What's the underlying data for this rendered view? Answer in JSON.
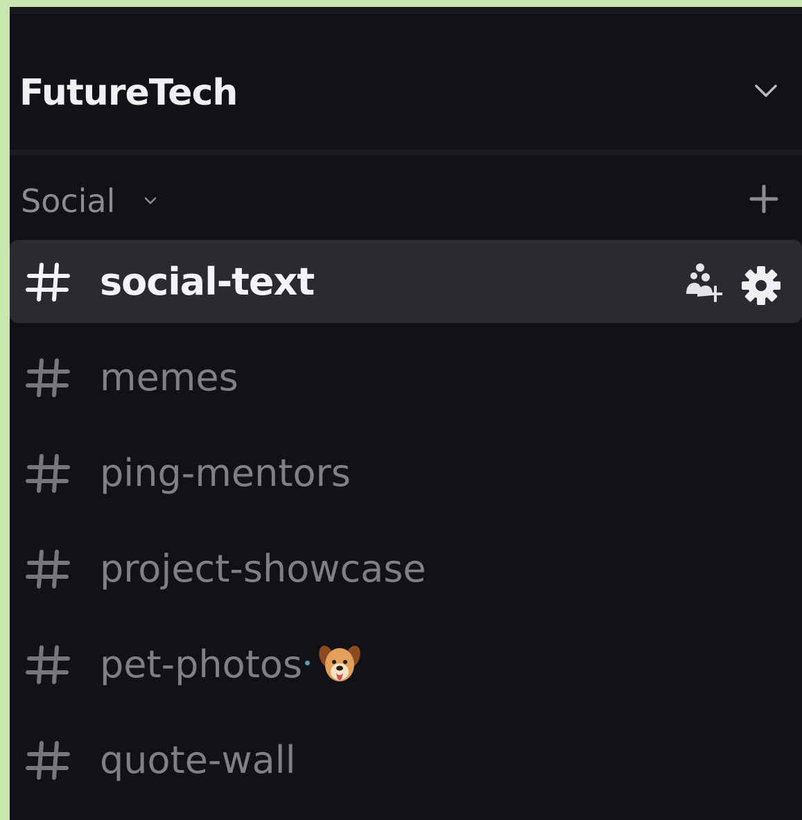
{
  "server": {
    "name": "FutureTech"
  },
  "category": {
    "label": "Social"
  },
  "channels": [
    {
      "label": "social-text",
      "active": true
    },
    {
      "label": "memes",
      "active": false
    },
    {
      "label": "ping-mentors",
      "active": false
    },
    {
      "label": "project-showcase",
      "active": false
    },
    {
      "label": "pet-photos",
      "active": false,
      "emoji": "dog-face-emoji"
    },
    {
      "label": "quote-wall",
      "active": false
    }
  ],
  "icons": {
    "header_chevron": "chevron-down-icon",
    "category_chevron": "chevron-down-icon",
    "add_channel": "plus-icon",
    "channel_hash": "hash-icon",
    "invite": "add-member-icon",
    "settings": "gear-icon"
  },
  "colors": {
    "background": "#121216",
    "active_row": "#2a2a31",
    "text_active": "#f4f4f6",
    "text_muted": "#7f8087",
    "outer_frame": "#c8e6b0"
  }
}
